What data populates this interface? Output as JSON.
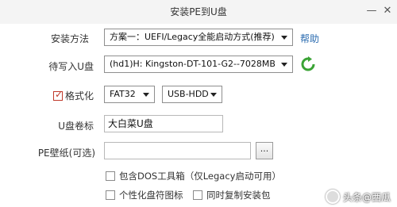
{
  "window": {
    "title": "安装PE到U盘",
    "minimize_icon": "minimize-icon",
    "close_icon": "close-icon"
  },
  "install_method": {
    "label": "安装方法",
    "value": "方案一：UEFI/Legacy全能启动方式(推荐)",
    "help_label": "帮助"
  },
  "target_drive": {
    "label": "待写入U盘",
    "value": "(hd1)H: Kingston-DT-101-G2--7028MB",
    "refresh_icon": "refresh-icon"
  },
  "format": {
    "label": "格式化",
    "checked": true,
    "filesystem": "FAT32",
    "mode": "USB-HDD"
  },
  "volume_label": {
    "label": "U盘卷标",
    "value": "大白菜U盘"
  },
  "wallpaper": {
    "label": "PE壁纸(可选)",
    "value": "",
    "browse_label": "..."
  },
  "options": [
    {
      "label": "包含DOS工具箱（仅Legacy启动可用）",
      "checked": false
    },
    {
      "label": "个性化盘符图标",
      "checked": false
    },
    {
      "label": "同时复制安装包",
      "checked": false
    }
  ],
  "watermark": {
    "text": "头条@西瓜"
  },
  "colors": {
    "accent_link": "#2b6cb0",
    "refresh_green": "#3aa335",
    "check_red": "#c0392b"
  }
}
